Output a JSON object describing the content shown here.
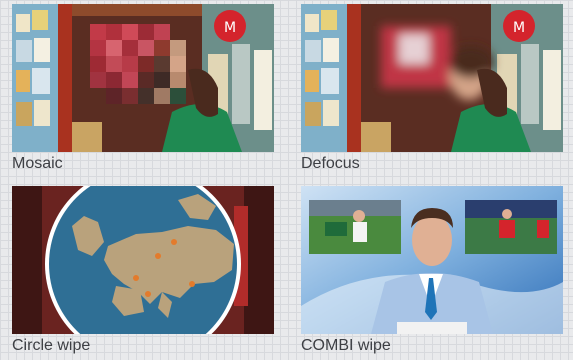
{
  "tiles": [
    {
      "label": "Mosaic"
    },
    {
      "label": "Defocus"
    },
    {
      "label": "Circle wipe"
    },
    {
      "label": "COMBI wipe"
    }
  ],
  "colors": {
    "background": "#e9eaec",
    "caption": "#3d3f44",
    "shirt_green": "#1f8a52",
    "lantern_red": "#d4242c",
    "map_sea": "#2f6f95",
    "map_land": "#b9a27c",
    "studio_blue": "#2f6fb8"
  },
  "icons": {
    "shop_scene": "shop-scene-image",
    "europe_map": "europe-map-image",
    "news_anchor": "news-anchor-image"
  }
}
